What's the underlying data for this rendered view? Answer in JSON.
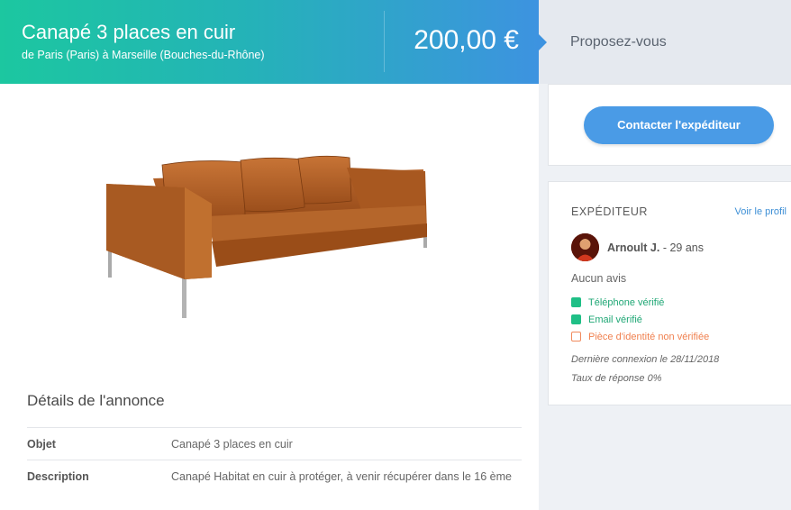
{
  "listing": {
    "title": "Canapé 3 places en cuir",
    "route": "de Paris (Paris) à Marseille (Bouches-du-Rhône)",
    "price": "200,00 €"
  },
  "offer": {
    "label": "Proposez-vous"
  },
  "contact": {
    "button_label": "Contacter l'expéditeur"
  },
  "sender": {
    "heading": "EXPÉDITEUR",
    "profile_link": "Voir le profil",
    "name": "Arnoult J.",
    "age": " - 29 ans",
    "reviews": "Aucun avis",
    "verifications": [
      {
        "label": "Téléphone vérifié",
        "status": "ok"
      },
      {
        "label": "Email vérifié",
        "status": "ok"
      },
      {
        "label": "Pièce d'identité non vérifiée",
        "status": "warning"
      }
    ],
    "last_login": "Dernière connexion le 28/11/2018",
    "response_rate": "Taux de réponse 0%"
  },
  "details": {
    "heading": "Détails de l'annonce",
    "rows": [
      {
        "key": "Objet",
        "value": "Canapé 3 places en cuir"
      },
      {
        "key": "Description",
        "value": "Canapé Habitat en cuir à protéger, à venir récupérer dans le 16 ème"
      }
    ]
  },
  "colors": {
    "header_start": "#1cc7a0",
    "header_end": "#3d93e0",
    "button": "#4a9be6",
    "verified": "#1fbf86",
    "warning": "#f08a5d"
  },
  "icons": {
    "verified": "checkbox-check-icon",
    "warning": "exclamation-box-icon"
  }
}
